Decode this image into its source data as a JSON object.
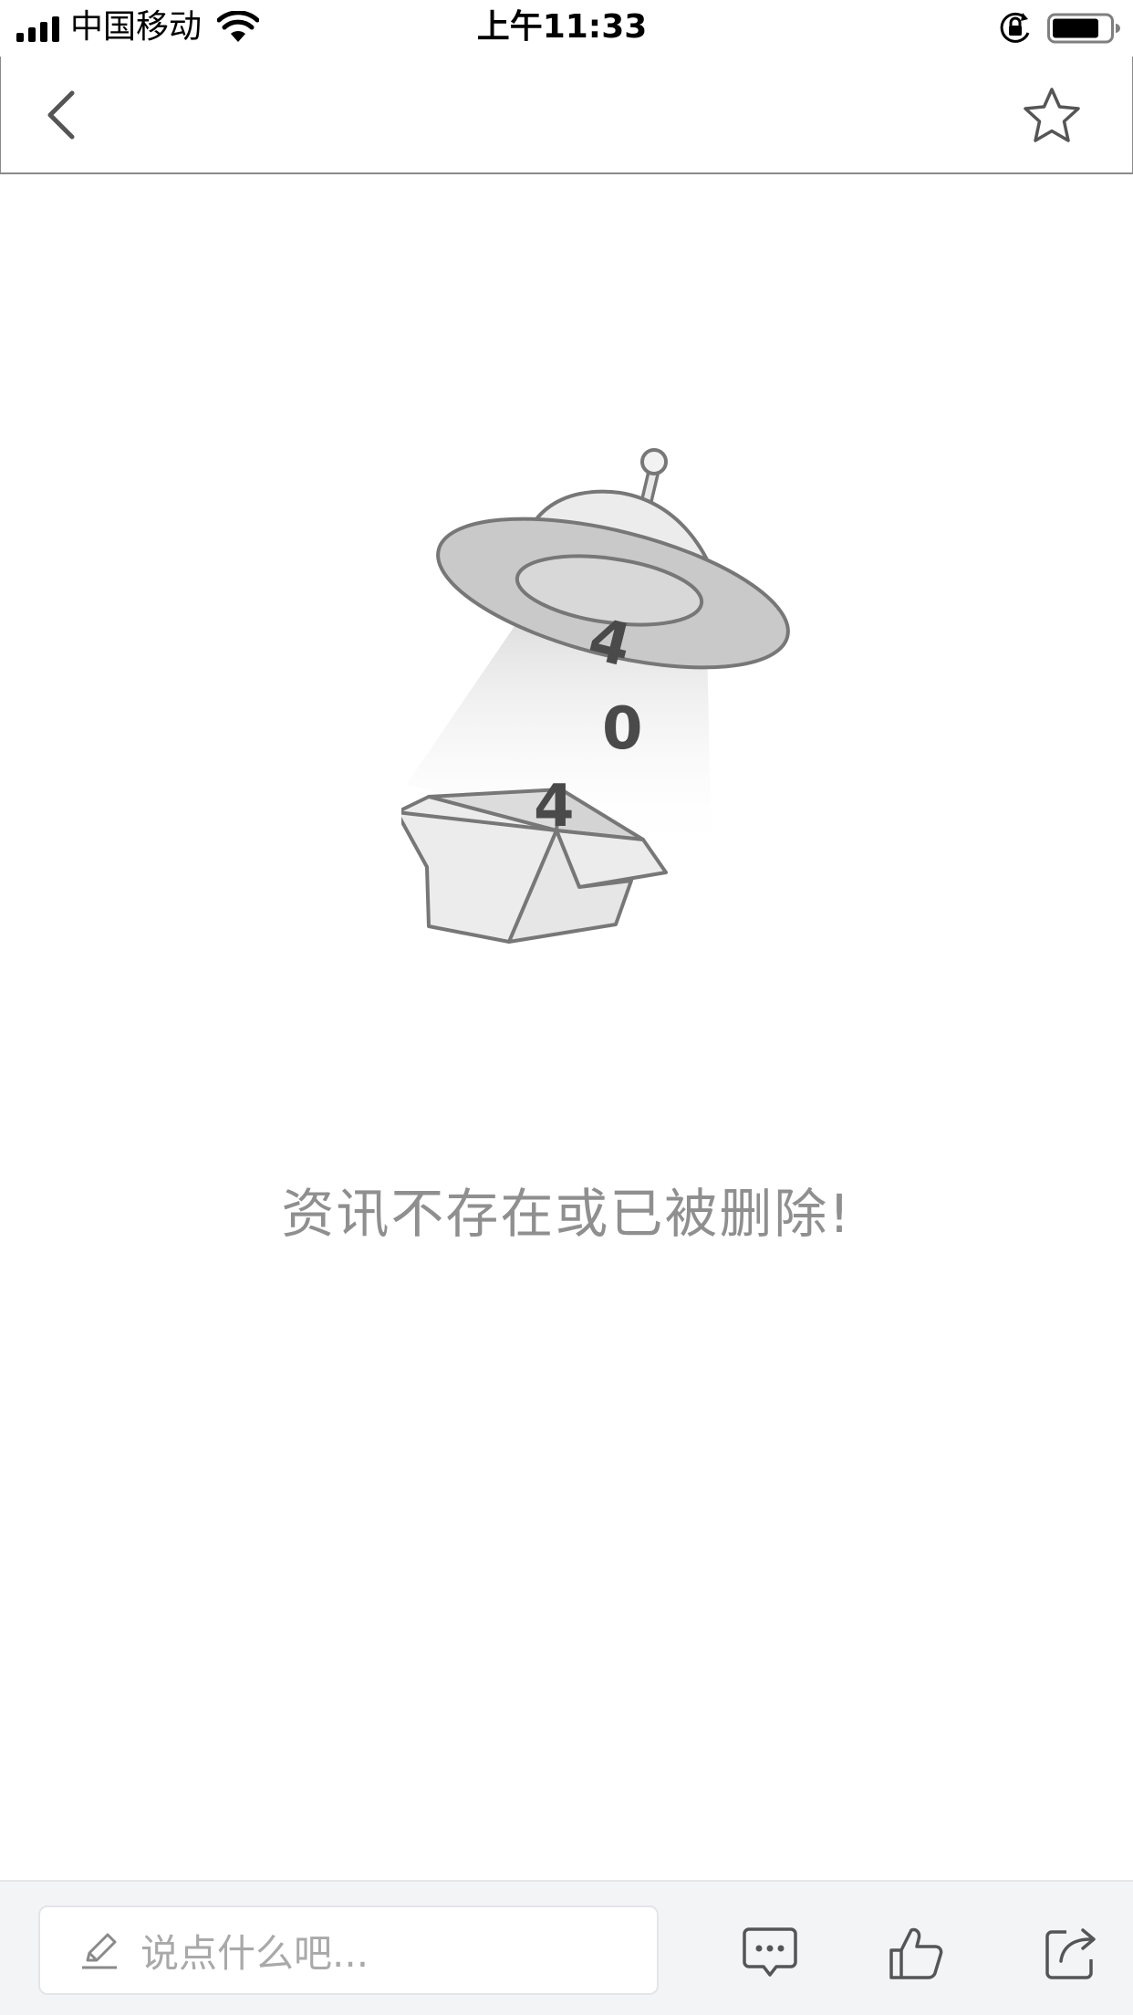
{
  "status_bar": {
    "carrier": "中国移动",
    "time": "上午11:33"
  },
  "nav": {
    "back_icon": "chevron-left-icon",
    "favorite_icon": "star-outline-icon"
  },
  "illustration": {
    "digits": [
      "4",
      "0",
      "4"
    ]
  },
  "message": "资讯不存在或已被删除!",
  "bottom_bar": {
    "comment_placeholder": "说点什么吧...",
    "icons": [
      "comment-icon",
      "like-icon",
      "share-icon"
    ]
  },
  "colors": {
    "text_gray": "#8f8f8f",
    "icon_gray": "#5a5a5a",
    "bar_bg": "#f3f4f6"
  }
}
